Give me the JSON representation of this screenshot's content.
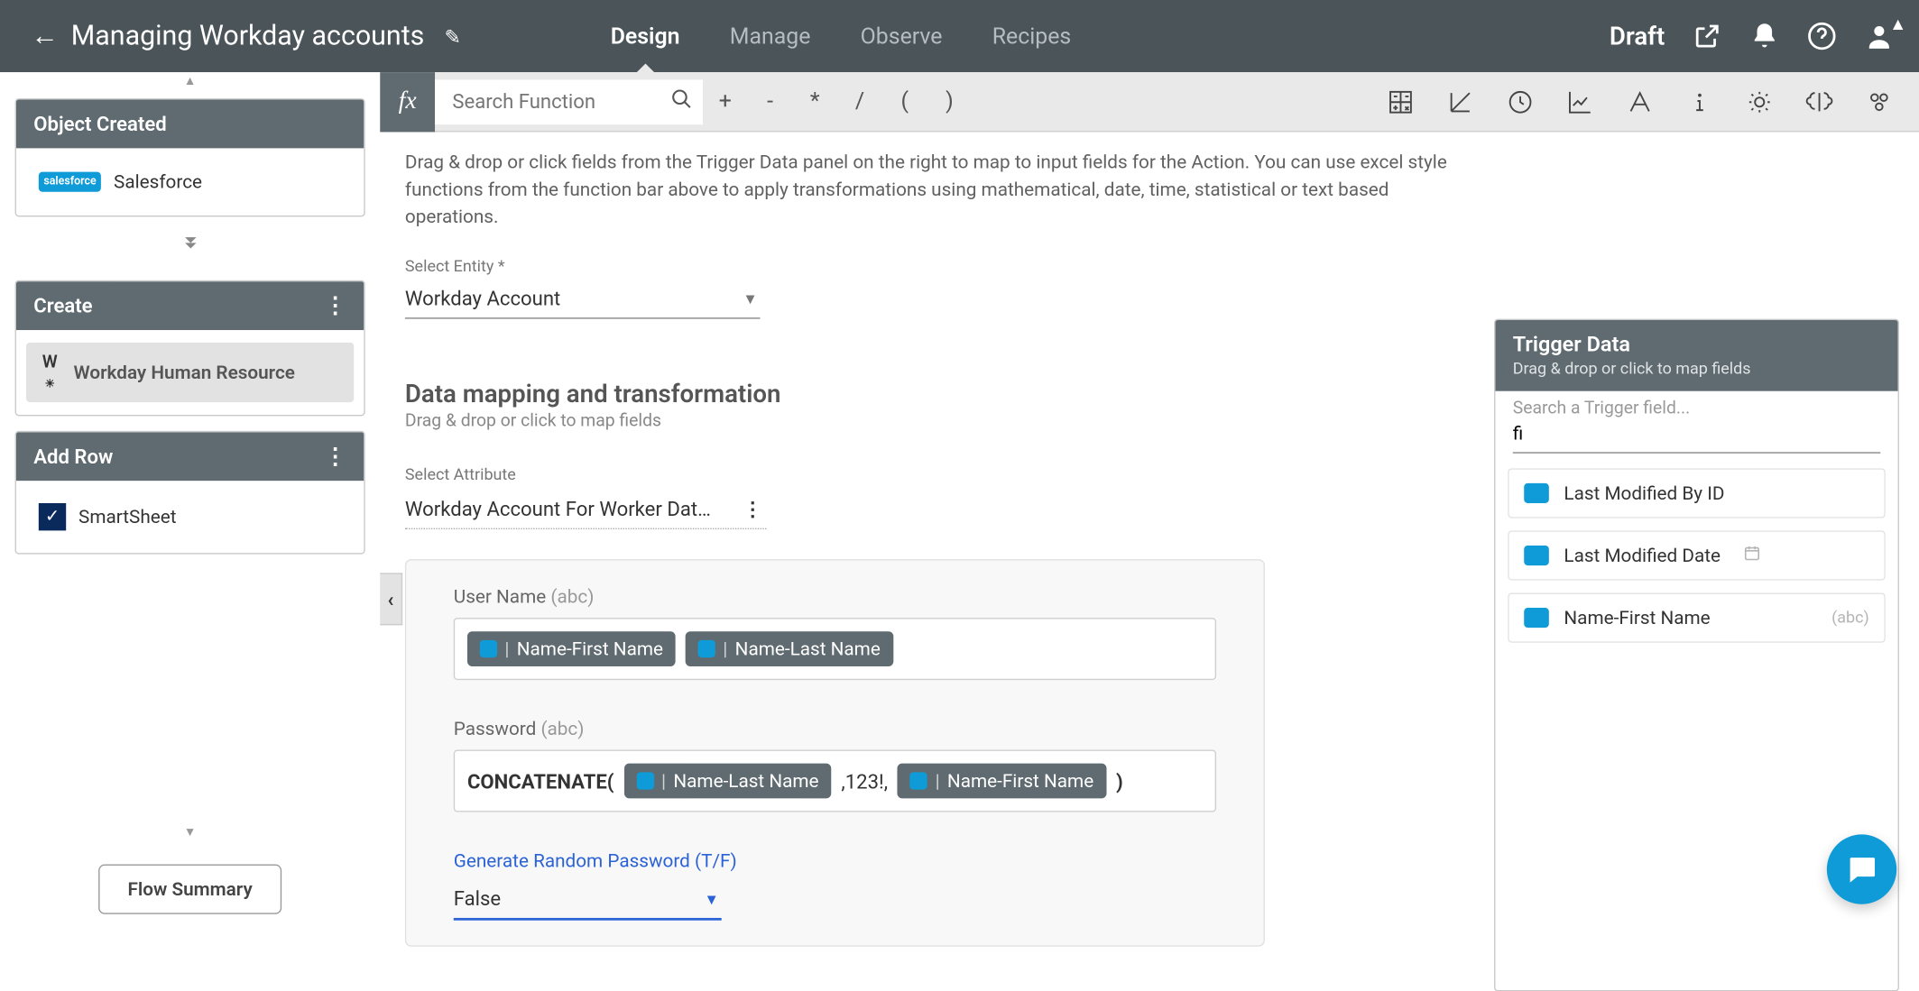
{
  "header": {
    "title": "Managing Workday accounts",
    "tabs": [
      "Design",
      "Manage",
      "Observe",
      "Recipes"
    ],
    "active_tab": "Design",
    "status": "Draft"
  },
  "sidebar": {
    "cards": [
      {
        "title": "Object Created",
        "items": [
          {
            "icon": "salesforce",
            "label": "Salesforce"
          }
        ],
        "menu": false
      },
      {
        "title": "Create",
        "items": [
          {
            "icon": "workday",
            "label": "Workday Human Resource"
          }
        ],
        "menu": true,
        "selected": true
      },
      {
        "title": "Add Row",
        "items": [
          {
            "icon": "smartsheet",
            "label": "SmartSheet"
          }
        ],
        "menu": true
      }
    ],
    "flow_summary": "Flow Summary"
  },
  "function_bar": {
    "search_placeholder": "Search Function",
    "ops": [
      "+",
      "-",
      "*",
      "/",
      "(",
      ")"
    ]
  },
  "help": "Drag & drop or click fields from the Trigger Data panel on the right to map to input fields for the Action. You can use excel style functions from the function bar above to apply transformations using mathematical, date, time, statistical or text based operations.",
  "entity": {
    "label": "Select Entity",
    "value": "Workday Account"
  },
  "mapping": {
    "title": "Data mapping and transformation",
    "subtitle": "Drag & drop or click to map fields",
    "attr_label": "Select Attribute",
    "attr_value": "Workday Account For Worker Dat…",
    "fields": {
      "username": {
        "label": "User Name",
        "type": "(abc)",
        "chips": [
          "Name-First Name",
          "Name-Last Name"
        ]
      },
      "password": {
        "label": "Password",
        "type": "(abc)",
        "fn_open": "CONCATENATE(",
        "chip1": "Name-Last Name",
        "mid": ",123!,",
        "chip2": "Name-First Name",
        "fn_close": ")"
      },
      "gen_pwd": {
        "label": "Generate Random Password (T/F)",
        "value": "False"
      }
    }
  },
  "trigger_panel": {
    "title": "Trigger Data",
    "subtitle": "Drag & drop or click to map fields",
    "search_placeholder": "Search a Trigger field...",
    "search_value": "fi",
    "items": [
      {
        "label": "Last Modified By ID",
        "meta": null,
        "date": false
      },
      {
        "label": "Last Modified Date",
        "meta": null,
        "date": true
      },
      {
        "label": "Name-First Name",
        "meta": "(abc)",
        "date": false
      }
    ]
  }
}
